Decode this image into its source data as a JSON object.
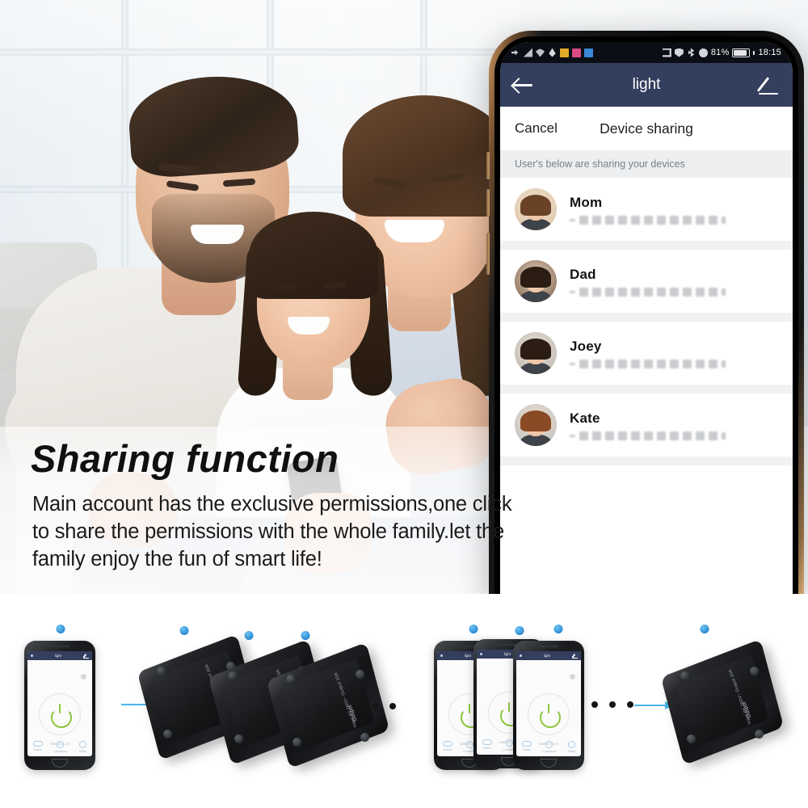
{
  "hero": {
    "alt": "family-photo-father-daughter-mother-smiling-at-phone"
  },
  "phone": {
    "status_bar": {
      "left_icons": [
        "sync-icon",
        "signal-icon",
        "wifi-icon",
        "droplet-icon",
        "app-yellow-icon",
        "app-pink-icon",
        "app-blue-icon"
      ],
      "right_icons": [
        "nfc-icon",
        "shield-icon",
        "bluetooth-icon",
        "dnd-icon"
      ],
      "battery_percent": "81%",
      "time": "18:15"
    },
    "app_bar": {
      "back_icon": "back-arrow-icon",
      "title": "light",
      "edit_icon": "pencil-icon"
    },
    "sheet": {
      "cancel_label": "Cancel",
      "title": "Device sharing",
      "note": "User's below are sharing your devices"
    },
    "users": [
      {
        "name": "Mom",
        "phone_masked": "+00 0000 00000 0",
        "avatar": "avatar-mom"
      },
      {
        "name": "Dad",
        "phone_masked": "+00 0000 00000 0",
        "avatar": "avatar-dad"
      },
      {
        "name": "Joey",
        "phone_masked": "+00 0000 00000 0",
        "avatar": "avatar-joey"
      },
      {
        "name": "Kate",
        "phone_masked": "+00 0000 00000 0",
        "avatar": "avatar-kate"
      }
    ]
  },
  "caption": {
    "title": "Sharing  function",
    "line1": "Main account has the exclusive permissions,one click",
    "line2": "to share the permissions with the whole family.let the",
    "line3": "family enjoy the fun of smart life!"
  },
  "diagram": {
    "left_group": {
      "phone_count": 1,
      "device_count": 3,
      "ellipsis": "• • •",
      "arrow": "arrow-right-icon",
      "description": "one-phone-controls-many-devices"
    },
    "right_group": {
      "phone_count": 3,
      "device_count": 1,
      "ellipsis": "• • •",
      "arrow": "arrow-right-icon",
      "description": "many-phones-control-one-device"
    },
    "mini_app": {
      "title": "light",
      "power_state_label": "Switch is on",
      "tabs": [
        "Switch",
        "Countdown",
        "Timing"
      ]
    },
    "device_label": {
      "model": "S1",
      "brand": "Gdspot",
      "certs": "CE FC",
      "spec": "Input 90-250V~ Output 10A"
    }
  },
  "colors": {
    "app_bar": "#343e5e",
    "accent_green": "#8ec63f",
    "wifi_blue": "#1e8fe0",
    "arrow_blue": "#49b6ea",
    "sheet_note_bg": "#eceeef"
  }
}
